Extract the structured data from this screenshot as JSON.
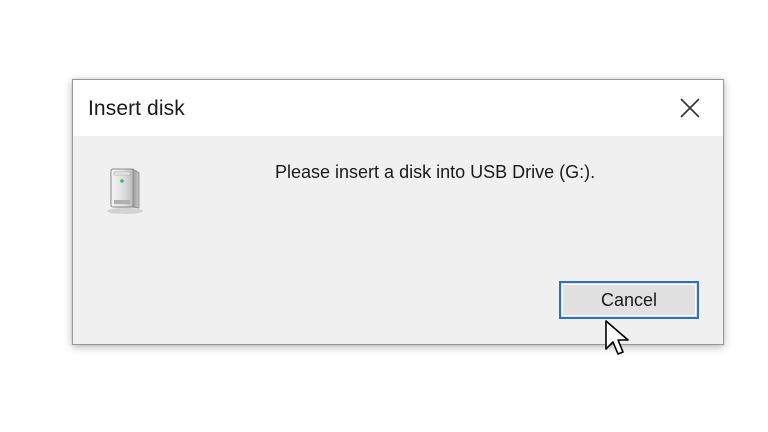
{
  "dialog": {
    "title": "Insert disk",
    "message": "Please insert a disk into USB Drive (G:).",
    "cancel_label": "Cancel"
  },
  "icons": {
    "close": "close-icon",
    "drive": "usb-drive-icon",
    "cursor": "mouse-pointer-icon"
  },
  "colors": {
    "titlebar": "#ffffff",
    "body": "#f0f0f0",
    "button_border": "#2a70c7",
    "button_fill": "#e1e1e1"
  }
}
